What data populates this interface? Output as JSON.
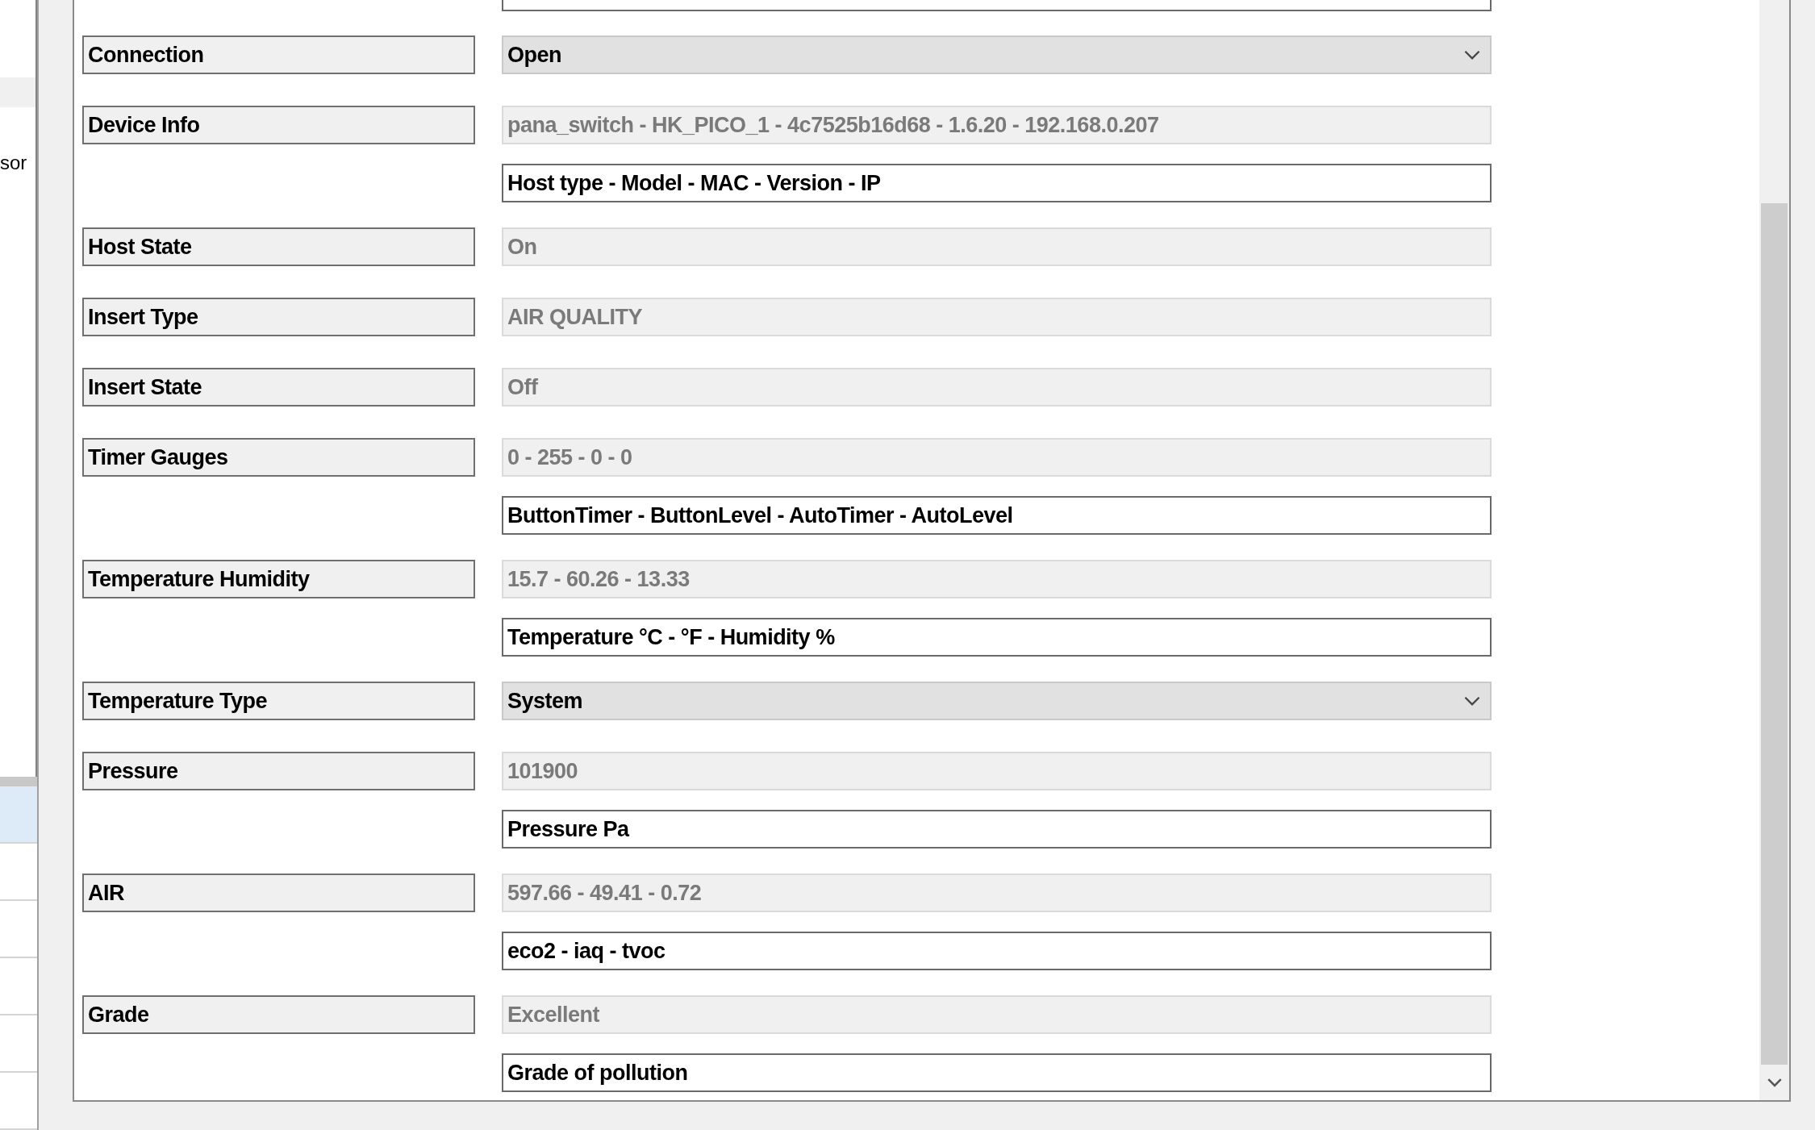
{
  "side_panel": {
    "items": [
      {
        "selected": true
      },
      {
        "label": "sor",
        "selected": false
      }
    ]
  },
  "side_list": {
    "rows": [
      {
        "selected": true
      },
      {
        "selected": false
      },
      {
        "selected": false
      },
      {
        "selected": false
      },
      {
        "selected": false
      },
      {
        "selected": false
      }
    ]
  },
  "form": {
    "fields": [
      {
        "label": "Connection",
        "kind": "dropdown",
        "value": "Open"
      },
      {
        "label": "Device Info",
        "kind": "readonly",
        "value": "pana_switch - HK_PICO_1 - 4c7525b16d68 - 1.6.20 - 192.168.0.207",
        "hint": "Host type - Model - MAC - Version - IP"
      },
      {
        "label": "Host State",
        "kind": "readonly",
        "value": "On"
      },
      {
        "label": "Insert Type",
        "kind": "readonly",
        "value": "AIR QUALITY"
      },
      {
        "label": "Insert State",
        "kind": "readonly",
        "value": "Off"
      },
      {
        "label": "Timer Gauges",
        "kind": "readonly",
        "value": "0 - 255 - 0 - 0",
        "hint": "ButtonTimer - ButtonLevel - AutoTimer - AutoLevel"
      },
      {
        "label": "Temperature Humidity",
        "kind": "readonly",
        "value": "15.7 - 60.26 - 13.33",
        "hint": "Temperature °C - °F - Humidity %"
      },
      {
        "label": "Temperature Type",
        "kind": "dropdown",
        "value": "System"
      },
      {
        "label": "Pressure",
        "kind": "readonly",
        "value": "101900",
        "hint": "Pressure Pa"
      },
      {
        "label": "AIR",
        "kind": "readonly",
        "value": "597.66 - 49.41 - 0.72",
        "hint": "eco2 - iaq - tvoc"
      },
      {
        "label": "Grade",
        "kind": "readonly",
        "value": "Excellent",
        "hint": "Grade of pollution"
      }
    ]
  }
}
